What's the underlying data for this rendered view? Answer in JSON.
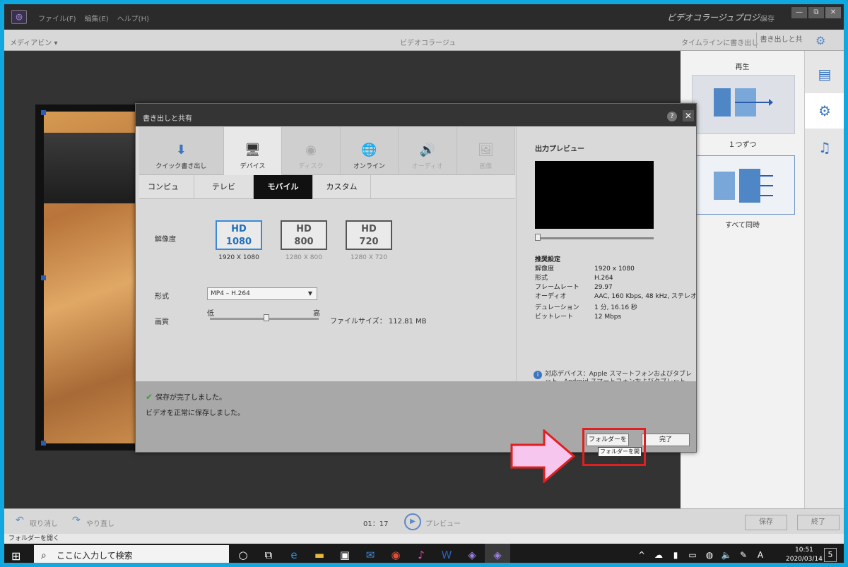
{
  "app": {
    "logo": "◎",
    "menu": [
      "ファイル(F)",
      "編集(E)",
      "ヘルプ(H)"
    ],
    "title": "ビデオコラージュプロジ...",
    "save_top": "保存",
    "window_buttons": [
      "—",
      "⧉",
      "✕"
    ]
  },
  "toolbar": {
    "media_bin": "メディアビン ▾",
    "center": "ビデオコラージュ",
    "timeline_export": "タイムラインに書き出し",
    "export_share": "書き出しと共有"
  },
  "right_panel": {
    "title": "再生",
    "options": [
      {
        "label": "１つずつ"
      },
      {
        "label": "すべて同時"
      }
    ]
  },
  "dialog": {
    "title": "書き出しと共有",
    "help": "?",
    "close": "✕",
    "categories": [
      {
        "icon": "⬇",
        "label": "クイック書き出し"
      },
      {
        "icon": "🖥",
        "label": "デバイス"
      },
      {
        "icon": "◉",
        "label": "ディスク"
      },
      {
        "icon": "🌐",
        "label": "オンライン"
      },
      {
        "icon": "🔊",
        "label": "オーディオ"
      },
      {
        "icon": "🖼",
        "label": "画像"
      }
    ],
    "subtabs": [
      "コンピューター",
      "テレビ",
      "モバイル",
      "カスタム"
    ],
    "resolution_label": "解像度",
    "resolutions": [
      {
        "line1": "HD",
        "line2": "1080",
        "caption": "1920 X 1080"
      },
      {
        "line1": "HD",
        "line2": "800",
        "caption": "1280 X 800"
      },
      {
        "line1": "HD",
        "line2": "720",
        "caption": "1280 X 720"
      }
    ],
    "format_label": "形式",
    "format_value": "MP4 – H.264",
    "quality_label": "画質",
    "quality_low": "低",
    "quality_high": "高",
    "quality_level_percent": 52,
    "filesize": "ファイルサイズ：  112.81 MB",
    "preview_title": "出力プレビュー",
    "spec_heading": "推奨設定",
    "specs": [
      {
        "k": "解像度",
        "v": "1920 x 1080"
      },
      {
        "k": "形式",
        "v": "H.264"
      },
      {
        "k": "フレームレート",
        "v": "29.97"
      },
      {
        "k": "オーディオ",
        "v": "AAC, 160 Kbps, 48 kHz, ステレオ"
      },
      {
        "k": "デュレーション",
        "v": "1 分, 16.16 秒"
      },
      {
        "k": "ビットレート",
        "v": "12 Mbps"
      }
    ],
    "device_info": "対応デバイス：Apple スマートフォンおよびタブレット、Android スマートフォンおよびタブレット",
    "status_saved": "保存が完了しました。",
    "status_success": "ビデオを正常に保存しました。",
    "open_folder": "フォルダーを開く",
    "done": "完了",
    "tooltip": "フォルダーを開く"
  },
  "bottom": {
    "undo": "取り消し",
    "redo": "やり直し",
    "time": "01：17",
    "preview": "プレビュー",
    "save": "保存",
    "exit": "終了"
  },
  "status_line": "フォルダーを開く",
  "taskbar": {
    "search_placeholder": "ここに入力して検索",
    "time": "10:51",
    "date": "2020/03/14",
    "notifications": "5",
    "ime": "A"
  },
  "colors": {
    "accent_blue": "#3a8ad8",
    "highlight_red": "#e02020",
    "arrow_pink": "#f7c6ee",
    "frame_border": "#11a8df"
  }
}
